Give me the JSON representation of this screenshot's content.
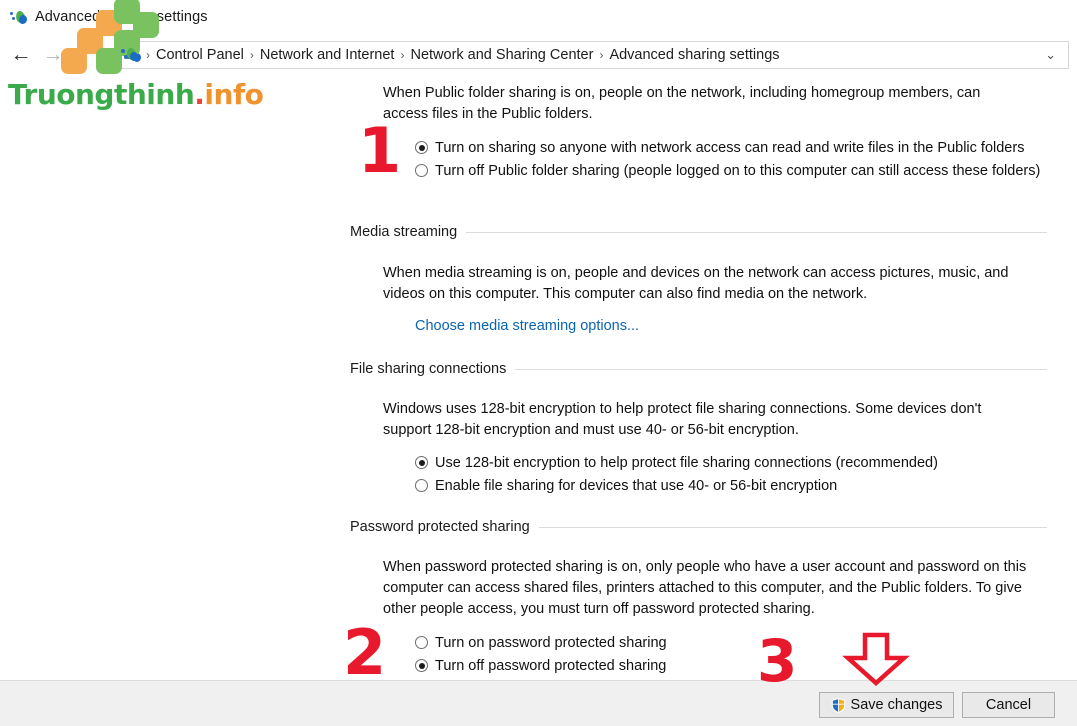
{
  "window": {
    "title": "Advanced sharing settings",
    "icon": "network-sharing-icon"
  },
  "nav": {
    "back_icon": "←",
    "forward_icon": "→",
    "recent_icon": "⌄",
    "up_icon": "↑",
    "address_chevron": "⌄",
    "breadcrumbs": [
      "Control Panel",
      "Network and Internet",
      "Network and Sharing Center",
      "Advanced sharing settings"
    ],
    "separator": "›"
  },
  "public_folder": {
    "description": "When Public folder sharing is on, people on the network, including homegroup members, can access files in the Public folders.",
    "options": [
      {
        "label": "Turn on sharing so anyone with network access can read and write files in the Public folders",
        "checked": true
      },
      {
        "label": "Turn off Public folder sharing (people logged on to this computer can still access these folders)",
        "checked": false
      }
    ]
  },
  "media_streaming": {
    "heading": "Media streaming",
    "description": "When media streaming is on, people and devices on the network can access pictures, music, and videos on this computer. This computer can also find media on the network.",
    "link": "Choose media streaming options..."
  },
  "file_sharing": {
    "heading": "File sharing connections",
    "description": "Windows uses 128-bit encryption to help protect file sharing connections. Some devices don't support 128-bit encryption and must use 40- or 56-bit encryption.",
    "options": [
      {
        "label": "Use 128-bit encryption to help protect file sharing connections (recommended)",
        "checked": true
      },
      {
        "label": "Enable file sharing for devices that use 40- or 56-bit encryption",
        "checked": false
      }
    ]
  },
  "password_sharing": {
    "heading": "Password protected sharing",
    "description": "When password protected sharing is on, only people who have a user account and password on this computer can access shared files, printers attached to this computer, and the Public folders. To give other people access, you must turn off password protected sharing.",
    "options": [
      {
        "label": "Turn on password protected sharing",
        "checked": false
      },
      {
        "label": "Turn off password protected sharing",
        "checked": true
      }
    ]
  },
  "footer": {
    "save_label": "Save changes",
    "save_icon": "uac-shield-icon",
    "cancel_label": "Cancel"
  },
  "annotations": {
    "step1": "1",
    "step2": "2",
    "step3": "3",
    "arrow": "down-arrow-annotation"
  },
  "watermark": {
    "text_green": "Truongthinh",
    "text_dot": ".",
    "text_orange": "info"
  },
  "colors": {
    "annotation_red": "#e8192c",
    "link_blue": "#0a64b4",
    "watermark_green": "#3aaa4a",
    "watermark_orange": "#f0922e",
    "footer_bg": "#f0f0f0"
  }
}
